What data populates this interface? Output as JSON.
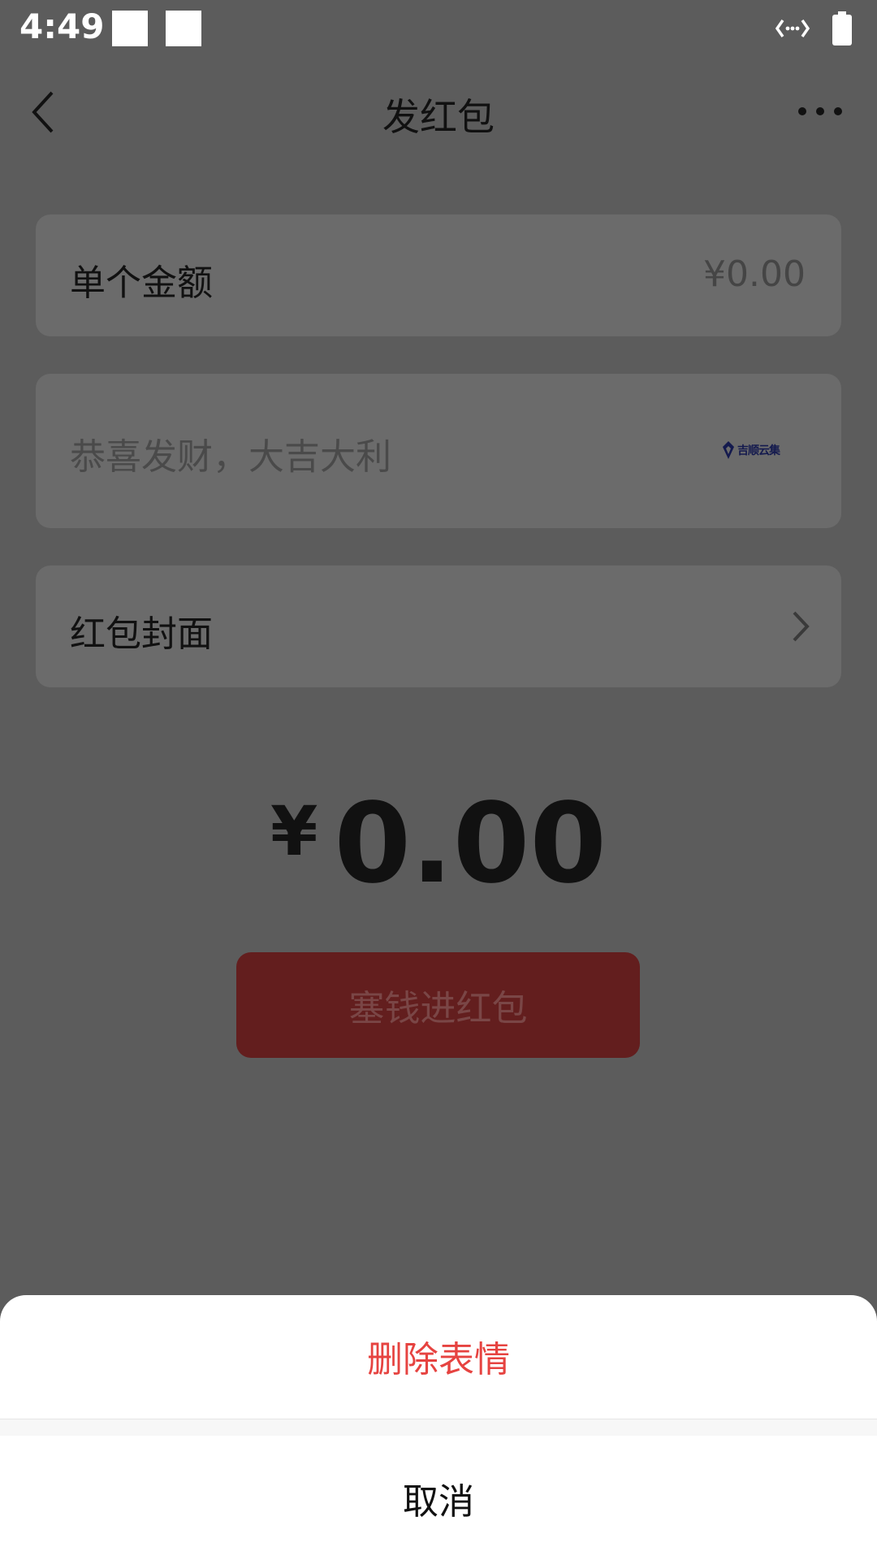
{
  "status_bar": {
    "time": "4:49"
  },
  "nav": {
    "title": "发红包"
  },
  "amount_row": {
    "label": "单个金额",
    "value": "¥0.00"
  },
  "message_row": {
    "placeholder": "恭喜发财，大吉大利",
    "sticker": "吉顺云集"
  },
  "cover_row": {
    "label": "红包封面"
  },
  "total": {
    "currency": "¥",
    "amount": "0.00"
  },
  "send_button": {
    "label": "塞钱进红包"
  },
  "action_sheet": {
    "delete_label": "删除表情",
    "cancel_label": "取消"
  },
  "colors": {
    "accent_red": "#e64340",
    "button_red": "#631e1e",
    "overlay": "#5c5c5c"
  }
}
